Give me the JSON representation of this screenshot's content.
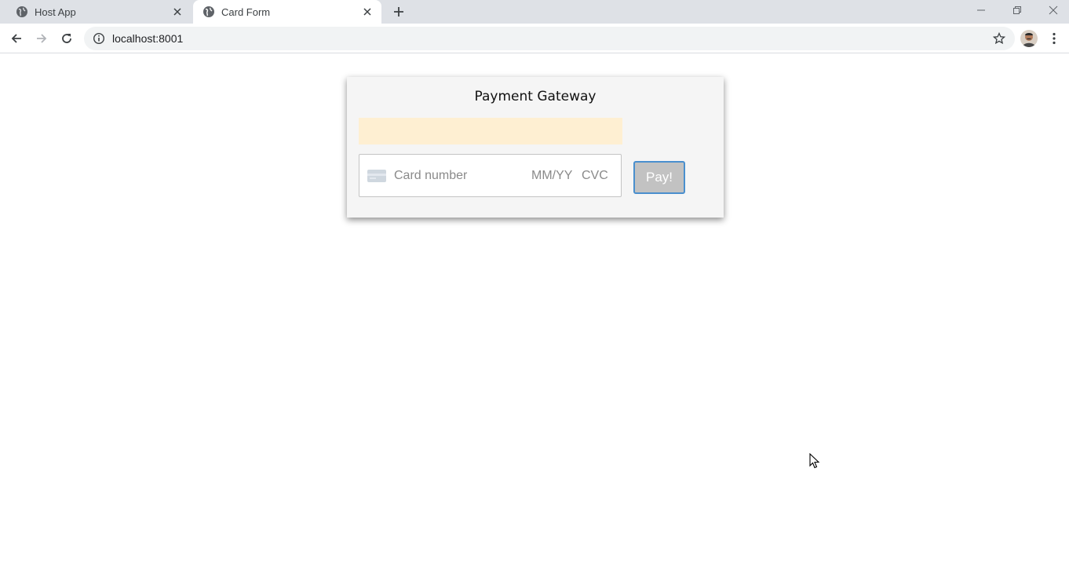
{
  "browser": {
    "tabs": [
      {
        "title": "Host App",
        "active": false,
        "icon": "globe-icon"
      },
      {
        "title": "Card Form",
        "active": true,
        "icon": "globe-icon"
      }
    ],
    "address": {
      "url": "localhost:8001"
    },
    "icons": {
      "back": "arrow-left-icon",
      "forward": "arrow-right-icon",
      "reload": "reload-icon",
      "info": "info-icon",
      "bookmark": "star-icon",
      "menu": "kebab-icon"
    }
  },
  "page": {
    "title": "Payment Gateway",
    "card_input": {
      "number_placeholder": "Card number",
      "expiry_placeholder": "MM/YY",
      "cvc_placeholder": "CVC"
    },
    "pay_label": "Pay!",
    "colors": {
      "card_bg": "#f5f5f5",
      "message_bg": "#feefd2",
      "button_bg": "#c2c2c2",
      "button_border": "#4a8fce"
    }
  }
}
